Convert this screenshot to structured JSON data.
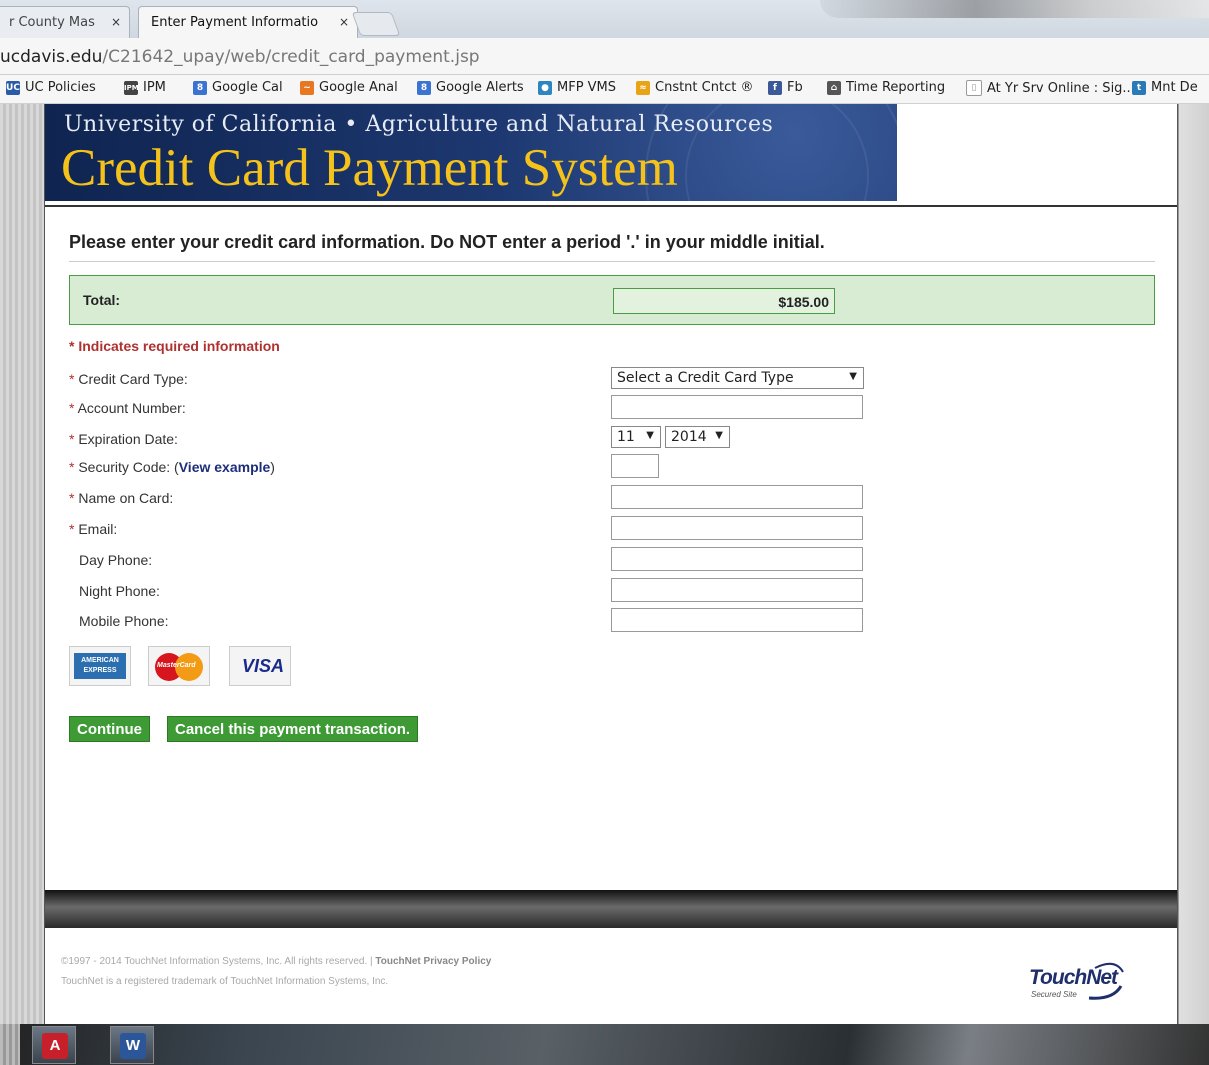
{
  "browser": {
    "tabs": [
      {
        "label": "r County Mas",
        "active": false
      },
      {
        "label": "Enter Payment Informatio",
        "active": true
      }
    ],
    "tab_close": "×",
    "url_host": "ucdavis.edu",
    "url_path": "/C21642_upay/web/credit_card_payment.jsp",
    "bookmarks": [
      {
        "label": "UC Policies",
        "icon": "UC",
        "color": "#2a5aa8"
      },
      {
        "label": "IPM",
        "icon": "IPM",
        "color": "#444"
      },
      {
        "label": "Google Cal",
        "icon": "8",
        "color": "#3b73d1"
      },
      {
        "label": "Google Anal",
        "icon": "~",
        "color": "#e87722"
      },
      {
        "label": "Google Alerts",
        "icon": "8",
        "color": "#3b73d1"
      },
      {
        "label": "MFP VMS",
        "icon": "●",
        "color": "#2e86c1"
      },
      {
        "label": "Cnstnt Cntct ®",
        "icon": "≈",
        "color": "#e8a317"
      },
      {
        "label": "Fb",
        "icon": "f",
        "color": "#3b5998"
      },
      {
        "label": "Time Reporting",
        "icon": "⌂",
        "color": "#555"
      },
      {
        "label": "At Yr Srv Online : Sig...",
        "icon": "▯",
        "color": "#999"
      },
      {
        "label": "Mnt De",
        "icon": "t",
        "color": "#2a7ab8"
      }
    ]
  },
  "banner": {
    "subtitle": "University of California • Agriculture and Natural Resources",
    "title": "Credit Card Payment System"
  },
  "form": {
    "heading": "Please enter your credit card information. Do NOT enter a period '.' in your middle initial.",
    "total_label": "Total:",
    "total_value": "$185.00",
    "required_note": "* Indicates required information",
    "required_star": "*",
    "fields": {
      "card_type": {
        "label": "Credit Card Type:",
        "value": "Select a Credit Card Type"
      },
      "account_number": {
        "label": "Account Number:",
        "value": ""
      },
      "expiration": {
        "label": "Expiration Date:",
        "month": "11",
        "year": "2014"
      },
      "security_code": {
        "label": "Security Code: (",
        "link": "View example",
        "suffix": ")",
        "value": ""
      },
      "name_on_card": {
        "label": "Name on Card:",
        "value": ""
      },
      "email": {
        "label": "Email:",
        "value": ""
      },
      "day_phone": {
        "label": "Day Phone:",
        "value": ""
      },
      "night_phone": {
        "label": "Night Phone:",
        "value": ""
      },
      "mobile_phone": {
        "label": "Mobile Phone:",
        "value": ""
      }
    },
    "card_logos": {
      "amex": "AMERICAN EXPRESS",
      "mastercard": "MasterCard",
      "visa": "VISA"
    },
    "buttons": {
      "continue": "Continue",
      "cancel": "Cancel this payment transaction."
    }
  },
  "footer": {
    "copyright": "©1997 - 2014 TouchNet Information Systems, Inc. All rights reserved. | ",
    "privacy_link": "TouchNet Privacy Policy",
    "trademark": "TouchNet is a registered trademark of TouchNet Information Systems, Inc.",
    "logo_name": "TouchNet",
    "logo_tagline": "Secured Site"
  },
  "taskbar": {
    "apps": [
      {
        "name": "acrobat",
        "glyph": "A",
        "color": "#c8202a"
      },
      {
        "name": "word",
        "glyph": "W",
        "color": "#2b579a"
      }
    ]
  }
}
